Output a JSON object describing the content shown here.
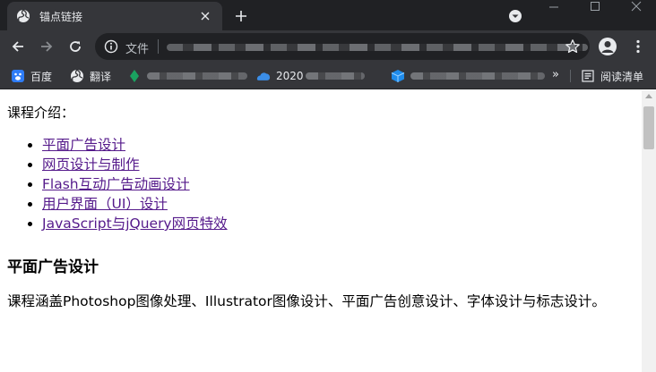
{
  "browser": {
    "tab": {
      "title": "锚点链接",
      "favicon": "globe-icon"
    },
    "toolbar": {
      "security_label": "文件"
    },
    "bookmarks": [
      {
        "label": "百度",
        "icon": "baidu-icon"
      },
      {
        "label": "翻译",
        "icon": "globe-icon"
      },
      {
        "label": "",
        "icon": "leaf-icon",
        "obscured": true
      },
      {
        "label": "2020",
        "icon": "cloud-icon",
        "obscured": true
      },
      {
        "label": "",
        "icon": "cube-icon",
        "obscured": true
      }
    ],
    "reading_list": {
      "label": "阅读清单",
      "icon": "reading-list-icon"
    },
    "colors": {
      "tabstrip": "#202124",
      "toolbar": "#35363a",
      "omnibox": "#202124",
      "text": "#e8eaed"
    }
  },
  "page": {
    "intro": "课程介绍：",
    "course_links": [
      "平面广告设计",
      "网页设计与制作",
      "Flash互动广告动画设计",
      "用户界面（UI）设计",
      "JavaScript与jQuery网页特效"
    ],
    "section": {
      "heading": "平面广告设计",
      "description": "课程涵盖Photoshop图像处理、Illustrator图像设计、平面广告创意设计、字体设计与标志设计。"
    },
    "colors": {
      "link": "#551a8b",
      "text": "#000000"
    }
  }
}
